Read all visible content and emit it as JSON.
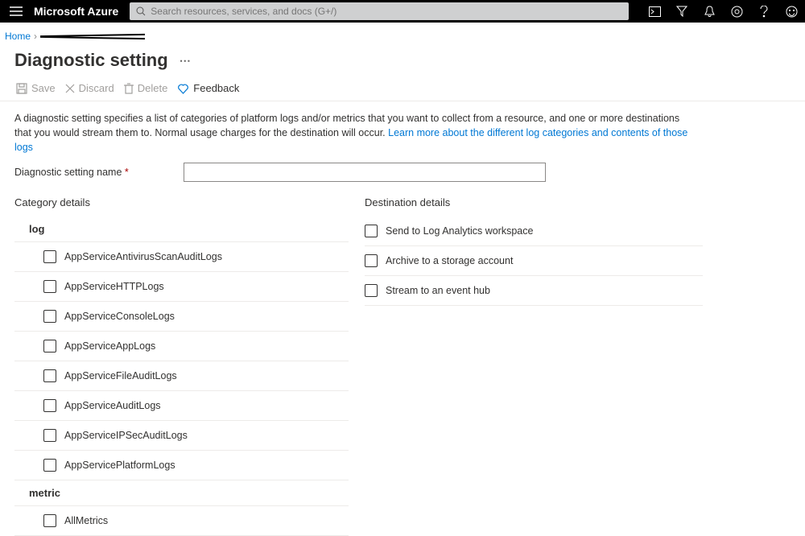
{
  "topbar": {
    "brand": "Microsoft Azure",
    "search_placeholder": "Search resources, services, and docs (G+/)"
  },
  "breadcrumb": {
    "home": "Home"
  },
  "page": {
    "title": "Diagnostic setting"
  },
  "toolbar": {
    "save": "Save",
    "discard": "Discard",
    "delete": "Delete",
    "feedback": "Feedback"
  },
  "description": {
    "text": "A diagnostic setting specifies a list of categories of platform logs and/or metrics that you want to collect from a resource, and one or more destinations that you would stream them to. Normal usage charges for the destination will occur. ",
    "link": "Learn more about the different log categories and contents of those logs"
  },
  "name_field": {
    "label": "Diagnostic setting name",
    "value": ""
  },
  "category": {
    "heading": "Category details",
    "log_group": "log",
    "metric_group": "metric",
    "logs": [
      "AppServiceAntivirusScanAuditLogs",
      "AppServiceHTTPLogs",
      "AppServiceConsoleLogs",
      "AppServiceAppLogs",
      "AppServiceFileAuditLogs",
      "AppServiceAuditLogs",
      "AppServiceIPSecAuditLogs",
      "AppServicePlatformLogs"
    ],
    "metrics": [
      "AllMetrics"
    ]
  },
  "destination": {
    "heading": "Destination details",
    "options": [
      "Send to Log Analytics workspace",
      "Archive to a storage account",
      "Stream to an event hub"
    ]
  }
}
